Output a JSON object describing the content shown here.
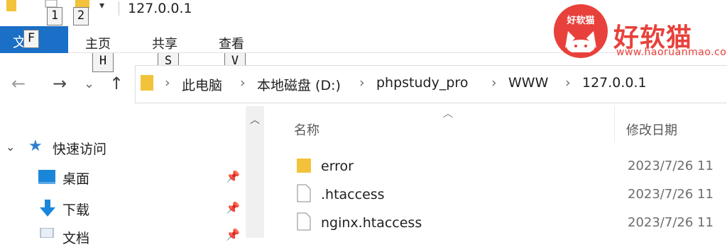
{
  "window": {
    "title": "127.0.0.1"
  },
  "keytips": {
    "qa1": "1",
    "qa2": "2",
    "file": "F",
    "home": "H",
    "share": "S",
    "view": "V"
  },
  "ribbon": {
    "file_label": "文件",
    "tabs": [
      {
        "label": "主页"
      },
      {
        "label": "共享"
      },
      {
        "label": "查看"
      }
    ]
  },
  "address": {
    "segments": [
      "此电脑",
      "本地磁盘 (D:)",
      "phpstudy_pro",
      "WWW",
      "127.0.0.1"
    ]
  },
  "nav_pane": {
    "quick_access": "快速访问",
    "items": [
      {
        "label": "桌面"
      },
      {
        "label": "下载"
      },
      {
        "label": "文档"
      }
    ]
  },
  "file_list": {
    "columns": {
      "name": "名称",
      "date": "修改日期"
    },
    "rows": [
      {
        "name": "error",
        "type": "folder",
        "date": "2023/7/26 11"
      },
      {
        "name": ".htaccess",
        "type": "file",
        "date": "2023/7/26 11"
      },
      {
        "name": "nginx.htaccess",
        "type": "file",
        "date": "2023/7/26 11"
      }
    ]
  },
  "watermark": {
    "badge": "好软猫",
    "title": "好软猫",
    "url": "www.haoruanmao.com"
  },
  "colors": {
    "accent": "#1a6fc6",
    "folder": "#f2c23a",
    "watermark": "#e8413b"
  }
}
